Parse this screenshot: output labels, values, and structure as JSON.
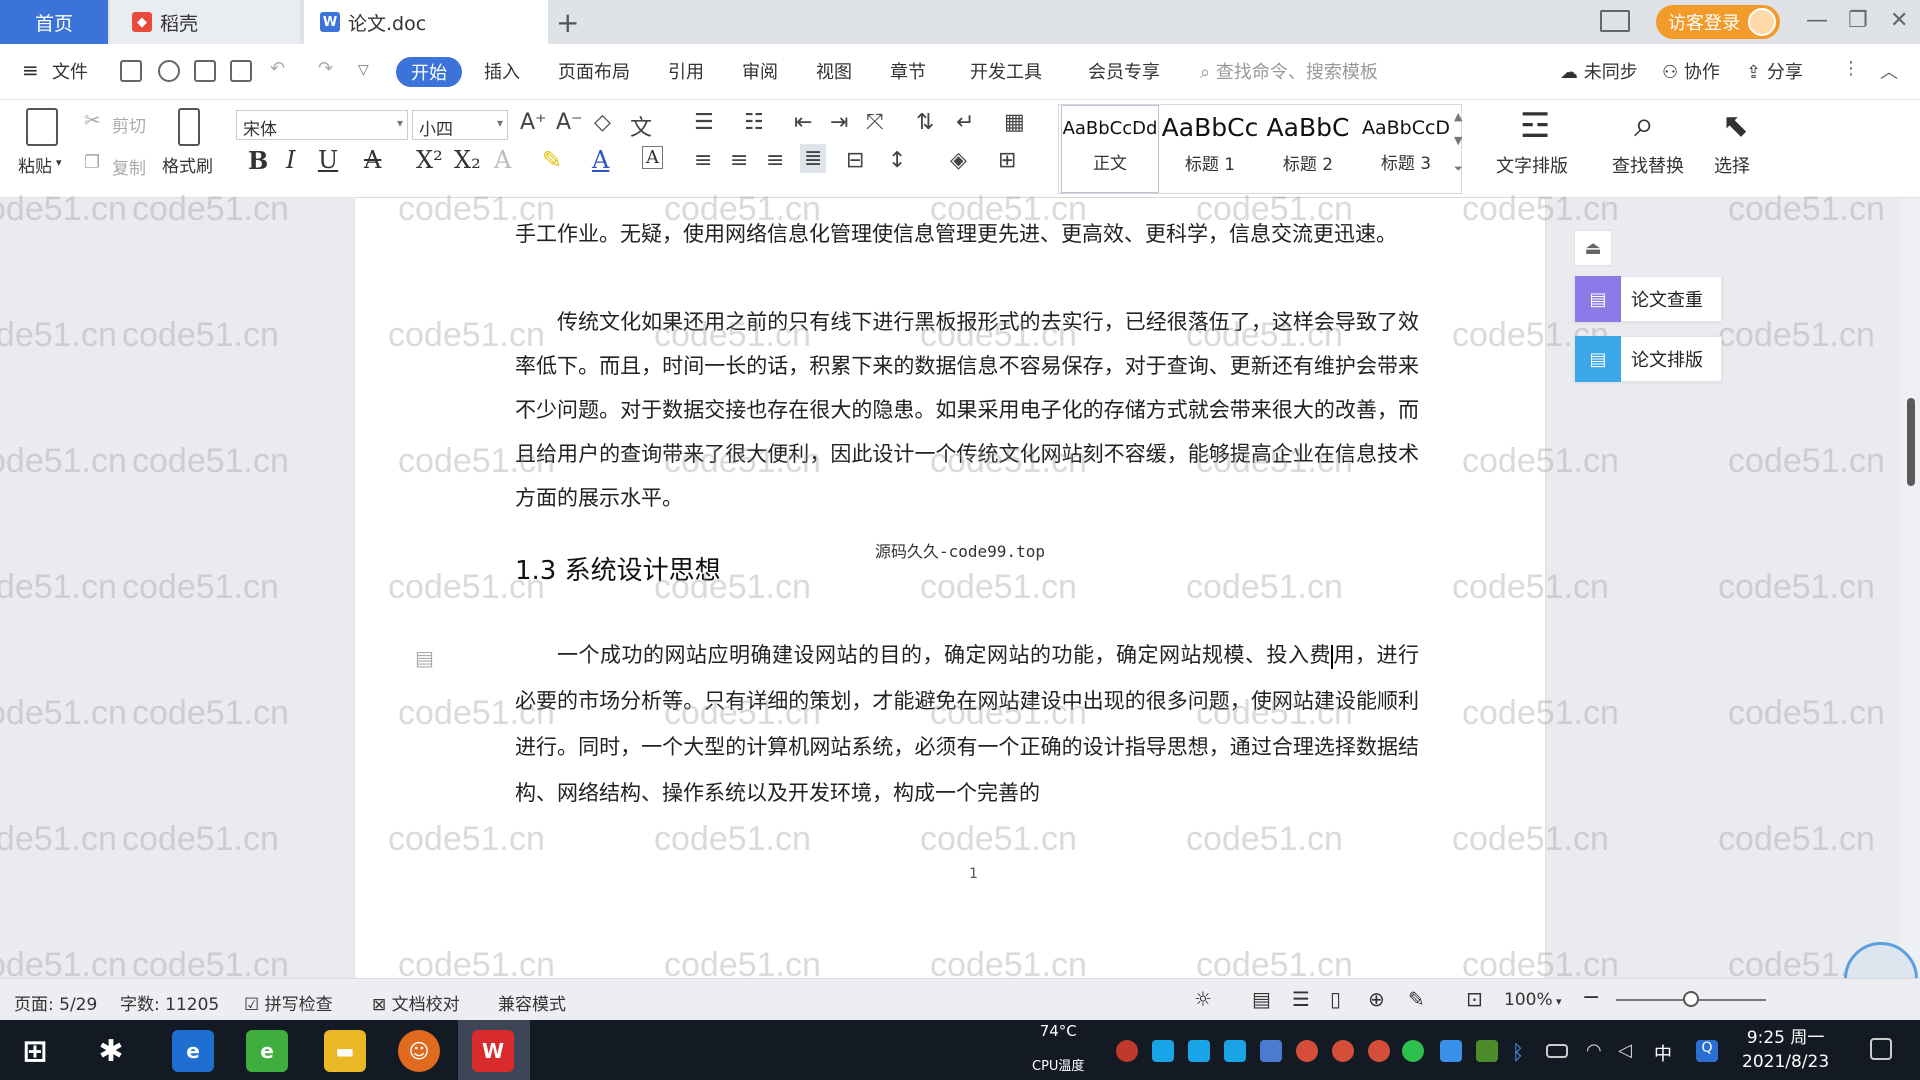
{
  "tabs": {
    "home": "首页",
    "daoke": "稻壳",
    "doc": "论文.doc",
    "plus": "+"
  },
  "topright": {
    "login": "访客登录"
  },
  "menu": {
    "file": "文件",
    "items": [
      "开始",
      "插入",
      "页面布局",
      "引用",
      "审阅",
      "视图",
      "章节",
      "开发工具",
      "会员专享"
    ],
    "search_placeholder": "查找命令、搜索模板",
    "sync": "未同步",
    "collab": "协作",
    "share": "分享"
  },
  "ribbon": {
    "paste": "粘贴",
    "cut": "剪切",
    "copy": "复制",
    "format_painter": "格式刷",
    "font": "宋体",
    "size": "小四",
    "styles": [
      {
        "preview": "AaBbCcDd",
        "name": "正文"
      },
      {
        "preview": "AaBbCc",
        "name": "标题 1"
      },
      {
        "preview": "AaBbC",
        "name": "标题 2"
      },
      {
        "preview": "AaBbCcD",
        "name": "标题 3"
      }
    ],
    "text_layout": "文字排版",
    "find_replace": "查找替换",
    "select": "选择"
  },
  "side": {
    "check": "论文查重",
    "layout": "论文排版"
  },
  "document": {
    "line_top": "手工作业。无疑，使用网络信息化管理使信息管理更先进、更高效、更科学，信息交流更迅速。",
    "para1": "传统文化如果还用之前的只有线下进行黑板报形式的去实行，已经很落伍了，这样会导致了效率低下。而且，时间一长的话，积累下来的数据信息不容易保存，对于查询、更新还有维护会带来不少问题。对于数据交接也存在很大的隐患。如果采用电子化的存储方式就会带来很大的改善，而且给用户的查询带来了很大便利，因此设计一个传统文化网站刻不容缓，能够提高企业在信息技术方面的展示水平。",
    "center_note": "源码久久-code99.top",
    "heading": "1.3 系统设计思想",
    "para2_first": "一个成功的网站应明确建设网站的目的，确定网站的功能，确定网站规模、投入费",
    "para2_rest": "用，进行必要的市场分析等。只有详细的策划，才能避免在网站建设中出现的很多问题，使网站建设能顺利进行。同时，一个大型的计算机网站系统，必须有一个正确的设计指导思想，通过合理选择数据结构、网络结构、操作系统以及开发环境，构成一个完善的",
    "page_number": "1",
    "watermark": "code51.cn"
  },
  "status": {
    "page": "页面: 5/29",
    "words": "字数: 11205",
    "spell": "拼写检查",
    "proof": "文档校对",
    "compat": "兼容模式",
    "zoom": "100%",
    "zoom_level": 0.5
  },
  "taskbar": {
    "temp": "74°C",
    "temp_label": "CPU温度",
    "time": "9:25 周一",
    "date": "2021/8/23",
    "ime": "中"
  },
  "colors": {
    "accent": "#3b73d8",
    "login": "#f29b2b",
    "taskbar": "#141a24"
  }
}
